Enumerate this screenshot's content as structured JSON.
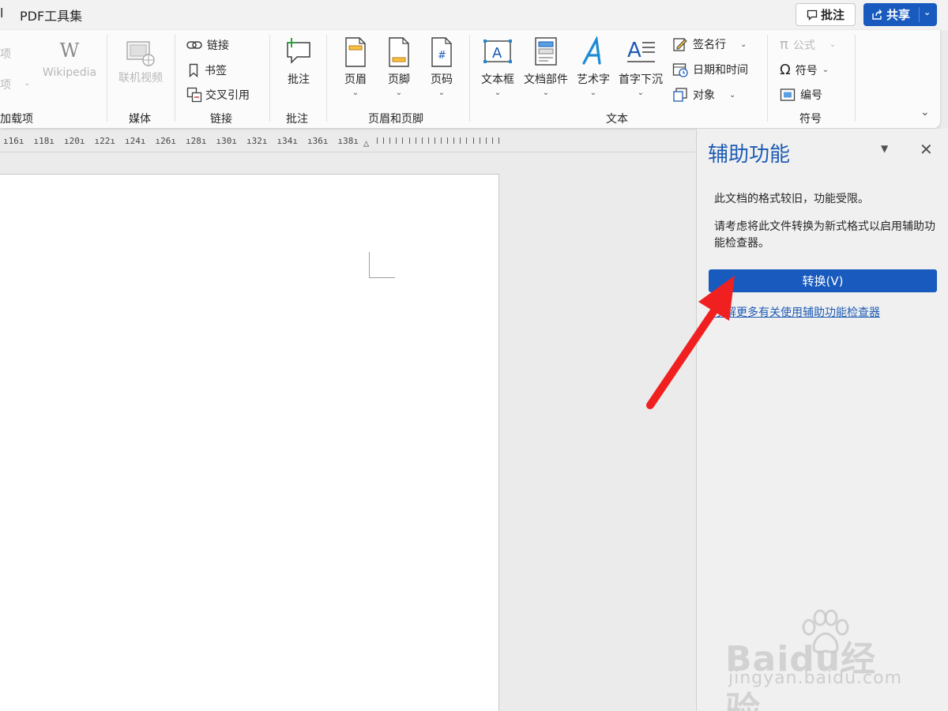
{
  "titlebar": {
    "tab_partial": "l",
    "tab_pdf": "PDF工具集",
    "comment_label": "批注",
    "share_label": "共享"
  },
  "ribbon": {
    "addins": {
      "row1": "项",
      "row2": "项",
      "wiki_label": "Wikipedia",
      "wiki_glyph": "W",
      "group": "加载项"
    },
    "media": {
      "online_video": "联机视频",
      "group": "媒体"
    },
    "links": {
      "link": "链接",
      "bookmark": "书签",
      "crossref": "交叉引用",
      "group": "链接"
    },
    "comments": {
      "comment": "批注",
      "group": "批注"
    },
    "header_footer": {
      "header": "页眉",
      "footer": "页脚",
      "page_number": "页码",
      "group": "页眉和页脚"
    },
    "text": {
      "textbox": "文本框",
      "quick_parts": "文档部件",
      "wordart": "艺术字",
      "dropcap": "首字下沉",
      "signature": "签名行",
      "datetime": "日期和时间",
      "object": "对象",
      "group": "文本"
    },
    "symbols": {
      "equation": "公式",
      "symbol": "符号",
      "number": "编号",
      "group": "符号"
    }
  },
  "ruler": {
    "marks": [
      "16",
      "18",
      "20",
      "22",
      "24",
      "26",
      "28",
      "30",
      "32",
      "34",
      "36",
      "38"
    ]
  },
  "pane": {
    "title": "辅助功能",
    "message1": "此文档的格式较旧，功能受限。",
    "message2": "请考虑将此文件转换为新式格式以启用辅助功能检查器。",
    "convert_label": "转换(V)",
    "learn_more": "了解更多有关使用辅助功能检查器"
  },
  "watermark": {
    "main": "Baidu经验",
    "sub": "jingyan.baidu.com"
  },
  "colors": {
    "accent": "#185abd",
    "pane_title": "#1e5bb5",
    "arrow": "#f02020"
  }
}
